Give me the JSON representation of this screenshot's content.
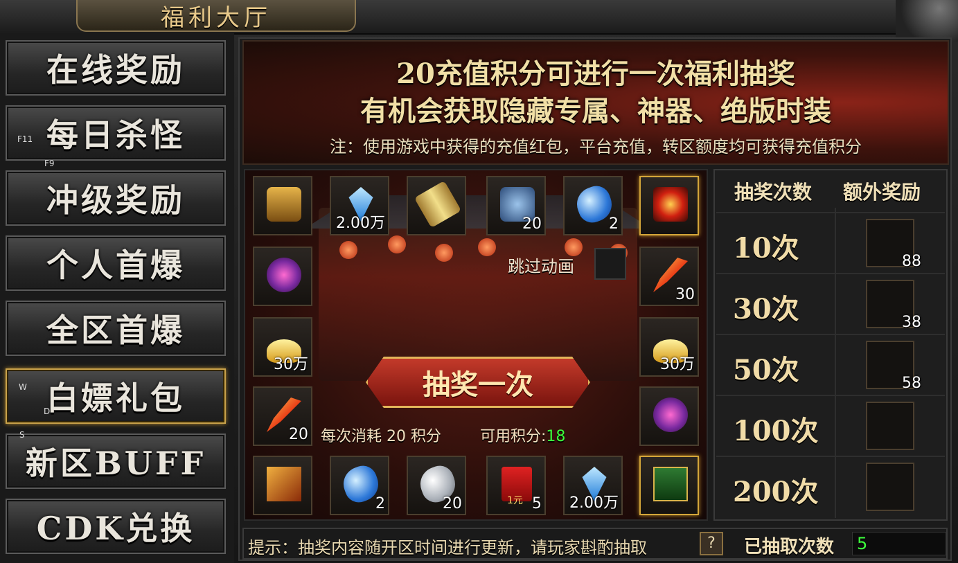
{
  "window": {
    "title": "福利大厅"
  },
  "sidebar": {
    "items": [
      {
        "label": "在线奖励"
      },
      {
        "label": "每日杀怪"
      },
      {
        "label": "冲级奖励"
      },
      {
        "label": "个人首爆"
      },
      {
        "label": "全区首爆"
      },
      {
        "label": "白嫖礼包"
      },
      {
        "label": "新区BUFF"
      },
      {
        "label": "CDK兑换"
      }
    ],
    "active_index": 5,
    "key_hints": [
      "F11",
      "F9",
      "W",
      "D",
      "S"
    ]
  },
  "banner": {
    "line1": "20充值积分可进行一次福利抽奖",
    "line2": "有机会获取隐藏专属、神器、绝版时装",
    "note": "注：使用游戏中获得的充值红包，平台充值，转区额度均可获得充值积分"
  },
  "prize_grid": {
    "top": [
      {
        "icon": "treasure-chest-icon",
        "count": ""
      },
      {
        "icon": "diamond-icon",
        "count": "2.00万"
      },
      {
        "icon": "scroll-icon",
        "count": ""
      },
      {
        "icon": "puzzle-piece-icon",
        "count": "20"
      },
      {
        "icon": "blue-stone-icon",
        "count": "2"
      },
      {
        "icon": "vortex-emblem-icon",
        "count": "",
        "highlight": true
      }
    ],
    "left": [
      {
        "icon": "purple-orb-icon",
        "count": ""
      },
      {
        "icon": "gold-ingot-icon",
        "count": "30万"
      },
      {
        "icon": "fire-feather-icon",
        "count": "20"
      }
    ],
    "right": [
      {
        "icon": "fire-feather-icon",
        "count": "30"
      },
      {
        "icon": "gold-ingot-icon",
        "count": "30万"
      },
      {
        "icon": "purple-orb-icon",
        "count": ""
      }
    ],
    "bottom": [
      {
        "icon": "fire-cube-icon",
        "count": ""
      },
      {
        "icon": "blue-stone-icon",
        "count": "2"
      },
      {
        "icon": "white-stone-icon",
        "count": "20"
      },
      {
        "icon": "red-envelope-icon",
        "count": "5",
        "inner_label": "1元"
      },
      {
        "icon": "diamond-icon",
        "count": "2.00万"
      },
      {
        "icon": "green-card-icon",
        "count": "",
        "highlight": true
      }
    ]
  },
  "draw": {
    "skip_label": "跳过动画",
    "button_label": "抽奖一次",
    "cost_label": "每次消耗 20 积分",
    "available_label": "可用积分:",
    "available_points": "18"
  },
  "ladder": {
    "header_times": "抽奖次数",
    "header_reward": "额外奖励",
    "rows": [
      {
        "times": "10次",
        "icon": "white-stone-icon",
        "count": "88"
      },
      {
        "times": "30次",
        "icon": "blue-stone-icon",
        "count": "38"
      },
      {
        "times": "50次",
        "icon": "purple-orb-icon",
        "count": "58"
      },
      {
        "times": "100次",
        "icon": "fire-ring-icon",
        "count": ""
      },
      {
        "times": "200次",
        "icon": "gold-armor-icon",
        "count": ""
      }
    ]
  },
  "footer": {
    "tip": "提示：抽奖内容随开区时间进行更新，请玩家斟酌抽取",
    "help_label": "?",
    "drawn_label": "已抽取次数",
    "drawn_count": "5"
  },
  "colors": {
    "accent_gold": "#d4a63a",
    "points_green": "#3cff3c",
    "button_red": "#c33a2a"
  }
}
